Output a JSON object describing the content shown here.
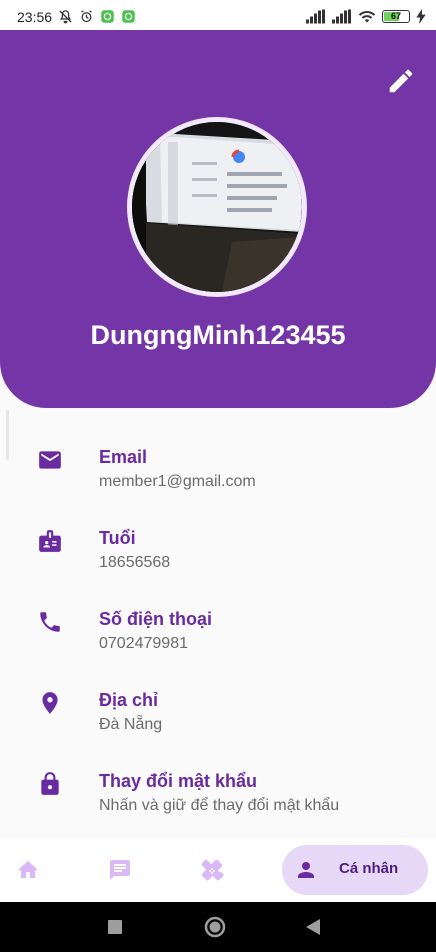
{
  "status_bar": {
    "time": "23:56",
    "battery_level": "67",
    "battery_percent": 67,
    "icons": [
      "mute-icon",
      "alarm-icon",
      "app-notification-icon",
      "app-notification-icon",
      "signal-icon",
      "signal-icon",
      "wifi-icon",
      "battery-icon",
      "charging-icon"
    ]
  },
  "profile": {
    "username": "DungngMinh123455",
    "edit_icon": "pencil-icon"
  },
  "info_items": [
    {
      "icon": "email-icon",
      "title": "Email",
      "value": "member1@gmail.com"
    },
    {
      "icon": "id-badge-icon",
      "title": "Tuổi",
      "value": "18656568"
    },
    {
      "icon": "phone-icon",
      "title": "Số điện thoại",
      "value": "0702479981"
    },
    {
      "icon": "location-pin-icon",
      "title": "Địa chỉ",
      "value": "Đà Nẵng"
    },
    {
      "icon": "lock-icon",
      "title": "Thay đổi mật khẩu",
      "value": "Nhấn và giữ để thay đổi mật khẩu"
    }
  ],
  "bottom_nav": {
    "items": [
      {
        "icon": "home-icon"
      },
      {
        "icon": "chat-icon"
      },
      {
        "icon": "bandage-icon"
      }
    ],
    "active": {
      "icon": "person-icon",
      "label": "Cá nhân"
    }
  },
  "colors": {
    "primary": "#7435a6",
    "title_text": "#6a2aa0",
    "nav_inactive": "#d9b8f5",
    "nav_active_bg": "#e8d8f8"
  }
}
